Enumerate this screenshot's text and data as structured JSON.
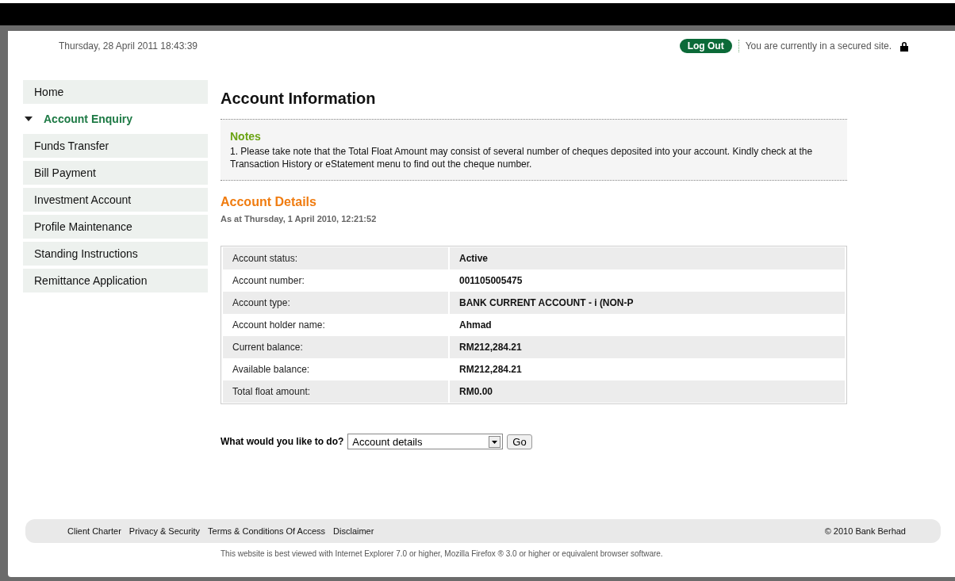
{
  "header": {
    "datetime": "Thursday, 28 April 2011 18:43:39",
    "logout_button": "Log Out",
    "security_note": "You are currently in a secured site."
  },
  "sidebar": {
    "items": [
      {
        "label": "Home",
        "selected": false
      },
      {
        "label": "Account Enquiry",
        "selected": true
      },
      {
        "label": "Funds Transfer",
        "selected": false
      },
      {
        "label": "Bill Payment",
        "selected": false
      },
      {
        "label": "Investment Account",
        "selected": false
      },
      {
        "label": "Profile Maintenance",
        "selected": false
      },
      {
        "label": "Standing Instructions",
        "selected": false
      },
      {
        "label": "Remittance Application",
        "selected": false
      }
    ]
  },
  "main": {
    "title": "Account Information",
    "notes": {
      "heading": "Notes",
      "text": "1. Please take note that the Total Float Amount may consist of several number of cheques deposited into your account. Kindly check at the Transaction History or eStatement menu to find out the cheque number."
    },
    "details_heading": "Account Details",
    "as_at": "As at Thursday, 1 April 2010, 12:21:52",
    "rows": [
      {
        "label": "Account status:",
        "value": "Active"
      },
      {
        "label": "Account number:",
        "value": "001105005475"
      },
      {
        "label": "Account type:",
        "value": "BANK CURRENT ACCOUNT - i (NON-P"
      },
      {
        "label": "Account holder name:",
        "value": "Ahmad"
      },
      {
        "label": "Current balance:",
        "value": "RM212,284.21"
      },
      {
        "label": "Available balance:",
        "value": "RM212,284.21"
      },
      {
        "label": "Total float amount:",
        "value": "RM0.00"
      }
    ],
    "action": {
      "label": "What would you like to do?",
      "select_value": "Account details",
      "button": "Go"
    }
  },
  "footer": {
    "links": [
      "Client Charter",
      "Privacy & Security",
      "Terms & Conditions Of Access",
      "Disclaimer"
    ],
    "copyright": "© 2010 Bank Berhad",
    "note": "This website is best viewed with Internet Explorer 7.0 or higher, Mozilla Firefox ® 3.0 or higher or equivalent browser software."
  }
}
